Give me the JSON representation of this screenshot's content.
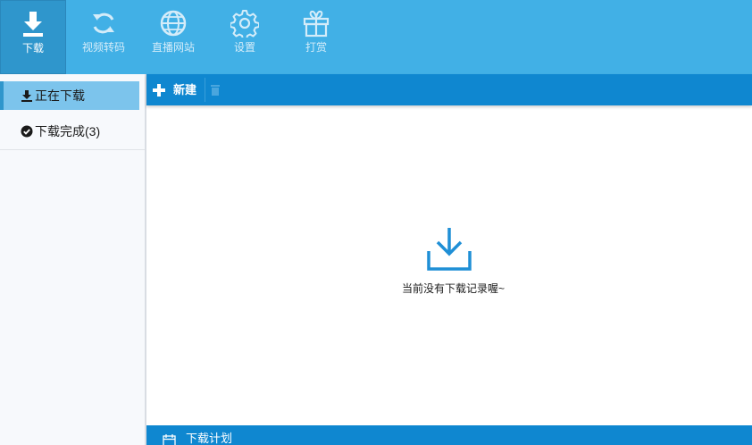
{
  "toolbar": {
    "items": [
      {
        "label": "下载",
        "icon": "download-icon",
        "active": true
      },
      {
        "label": "视频转码",
        "icon": "refresh-icon"
      },
      {
        "label": "直播网站",
        "icon": "globe-icon"
      },
      {
        "label": "设置",
        "icon": "gear-icon"
      },
      {
        "label": "打赏",
        "icon": "gift-icon"
      }
    ]
  },
  "sidebar": {
    "items": [
      {
        "label": "正在下载",
        "icon": "download-small-icon",
        "active": true
      },
      {
        "label": "下载完成(3)",
        "icon": "check-circle-icon"
      }
    ]
  },
  "actionbar": {
    "new_label": "新建"
  },
  "empty_state": {
    "text": "当前没有下载记录喔~",
    "icon": "download-tray-icon"
  },
  "bottombar": {
    "label": "下载计划",
    "icon": "calendar-icon"
  },
  "colors": {
    "topbar": "#41b0e6",
    "accent": "#0f87d0",
    "active_tool": "#2f96cc",
    "sidebar_active": "#7cc4ec"
  }
}
